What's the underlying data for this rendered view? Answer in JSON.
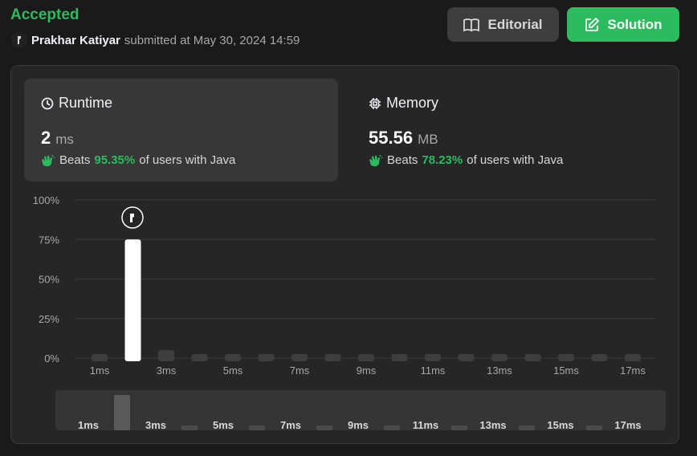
{
  "status": "Accepted",
  "submitter": {
    "name": "Prakhar Katiyar",
    "submitted_text": "submitted at May 30, 2024 14:59"
  },
  "buttons": {
    "editorial": "Editorial",
    "solution": "Solution"
  },
  "runtime": {
    "title": "Runtime",
    "value": "2",
    "unit": "ms",
    "beats_label": "Beats",
    "beats_pct": "95.35%",
    "beats_suffix": "of users with Java"
  },
  "memory": {
    "title": "Memory",
    "value": "55.56",
    "unit": "MB",
    "beats_label": "Beats",
    "beats_pct": "78.23%",
    "beats_suffix": "of users with Java"
  },
  "colors": {
    "accent_green": "#2cbb5d",
    "bar_default": "#3e3e3e",
    "bar_selected": "#ffffff"
  },
  "chart_data": {
    "type": "bar",
    "categories": [
      "1ms",
      "2ms",
      "3ms",
      "4ms",
      "5ms",
      "6ms",
      "7ms",
      "8ms",
      "9ms",
      "10ms",
      "11ms",
      "12ms",
      "13ms",
      "14ms",
      "15ms",
      "16ms",
      "17ms"
    ],
    "values": [
      1,
      75,
      5,
      1,
      1,
      1,
      1,
      1,
      1,
      1,
      1,
      1,
      1,
      1,
      1,
      1,
      1
    ],
    "selected_index": 1,
    "y_ticks": [
      "0%",
      "25%",
      "50%",
      "75%",
      "100%"
    ],
    "x_tick_labels": [
      "1ms",
      "3ms",
      "5ms",
      "7ms",
      "9ms",
      "11ms",
      "13ms",
      "15ms",
      "17ms"
    ],
    "ylim": [
      0,
      100
    ],
    "grid": true
  },
  "mini_chart": {
    "labels": [
      "1ms",
      "3ms",
      "5ms",
      "7ms",
      "9ms",
      "11ms",
      "13ms",
      "15ms",
      "17ms"
    ]
  }
}
